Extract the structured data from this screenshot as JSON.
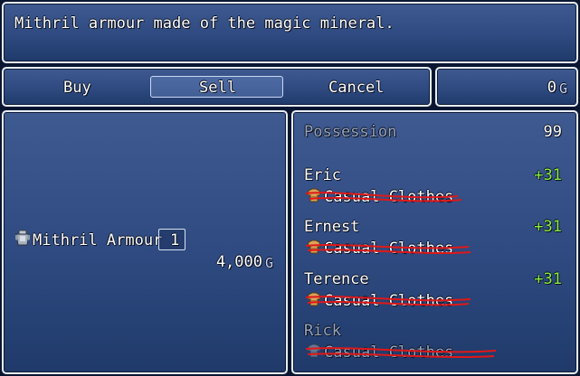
{
  "help": {
    "text": "Mithril armour made of the magic mineral."
  },
  "commands": [
    {
      "label": "Buy"
    },
    {
      "label": "Sell"
    },
    {
      "label": "Cancel"
    }
  ],
  "gold": {
    "value": "0",
    "unit": "G"
  },
  "item": {
    "name": "Mithril Armour",
    "icon": "armor-icon",
    "quantity": "1",
    "price": "4,000",
    "unit": "G"
  },
  "status": {
    "possession_label": "Possession",
    "possession_value": "99",
    "members": [
      {
        "name": "Eric",
        "delta": "+31",
        "equip": "Casual Clothes",
        "equip_icon": "clothes-icon"
      },
      {
        "name": "Ernest",
        "delta": "+31",
        "equip": "Casual Clothes",
        "equip_icon": "clothes-icon"
      },
      {
        "name": "Terence",
        "delta": "+31",
        "equip": "Casual Clothes",
        "equip_icon": "clothes-icon"
      },
      {
        "name": "Rick",
        "delta": "",
        "equip": "Casual Clothes",
        "equip_icon": "clothes-icon"
      }
    ]
  },
  "colors": {
    "positive": "#88ee44",
    "disabled": "#98a6bd",
    "strike": "#e01818"
  }
}
